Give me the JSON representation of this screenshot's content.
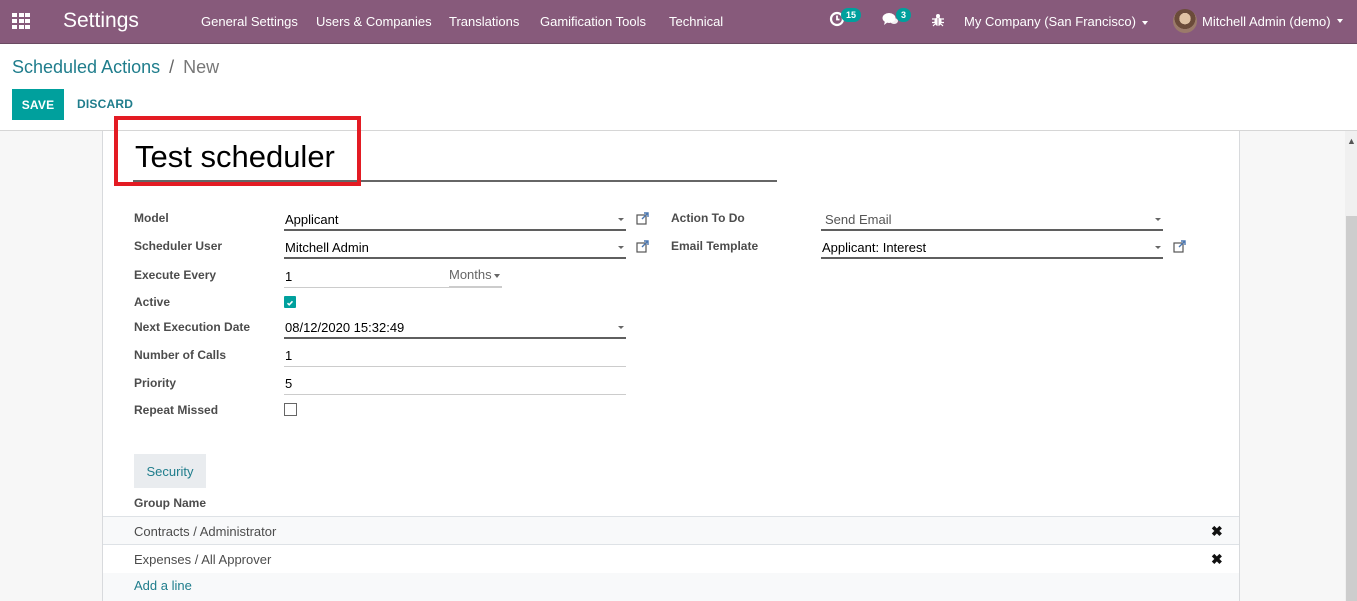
{
  "app": {
    "title": "Settings",
    "menu": [
      "General Settings",
      "Users & Companies",
      "Translations",
      "Gamification Tools",
      "Technical"
    ]
  },
  "systray": {
    "activity_count": "15",
    "message_count": "3",
    "company": "My Company (San Francisco)",
    "user": "Mitchell Admin (demo)"
  },
  "breadcrumb": {
    "parent": "Scheduled Actions",
    "separator": "/",
    "current": "New"
  },
  "buttons": {
    "save": "SAVE",
    "discard": "DISCARD"
  },
  "form": {
    "name": "Test scheduler",
    "left": {
      "model": {
        "label": "Model",
        "value": "Applicant"
      },
      "scheduler_user": {
        "label": "Scheduler User",
        "value": "Mitchell Admin"
      },
      "execute_every": {
        "label": "Execute Every",
        "value": "1",
        "unit": "Months"
      },
      "active": {
        "label": "Active",
        "checked": true
      },
      "next_execution_date": {
        "label": "Next Execution Date",
        "value": "08/12/2020 15:32:49"
      },
      "number_of_calls": {
        "label": "Number of Calls",
        "value": "1"
      },
      "priority": {
        "label": "Priority",
        "value": "5"
      },
      "repeat_missed": {
        "label": "Repeat Missed",
        "checked": false
      }
    },
    "right": {
      "action_to_do": {
        "label": "Action To Do",
        "value": "Send Email"
      },
      "email_template": {
        "label": "Email Template",
        "value": "Applicant: Interest"
      }
    }
  },
  "notebook": {
    "tabs": [
      "Security"
    ],
    "column": "Group Name",
    "rows": [
      "Contracts / Administrator",
      "Expenses / All Approver"
    ],
    "add_line": "Add a line"
  },
  "colors": {
    "brand": "#875a7b",
    "primary": "#00a09d",
    "link": "#1f7d8c",
    "highlight": "#e31b23"
  }
}
